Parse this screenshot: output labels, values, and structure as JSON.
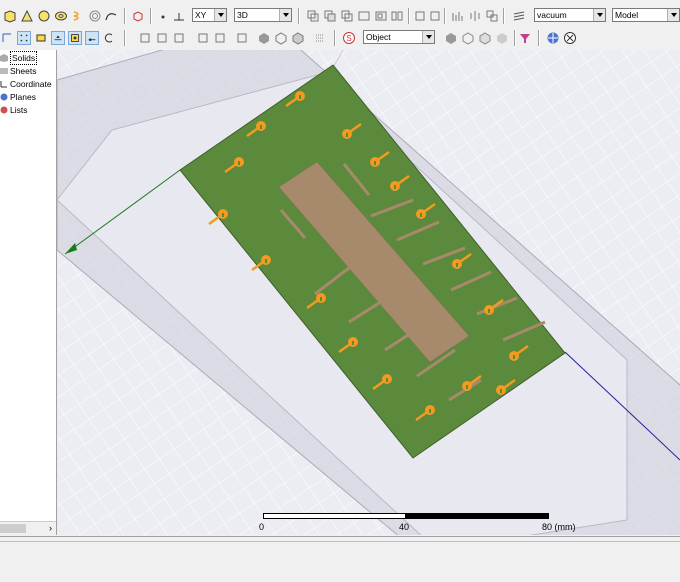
{
  "toolbar": {
    "plane_select": "XY",
    "view_select": "3D",
    "material_select": "vacuum",
    "mode_select": "Model",
    "object_select": "Object"
  },
  "tree": {
    "items": [
      {
        "label": "Solids"
      },
      {
        "label": "Sheets"
      },
      {
        "label": "Coordinate"
      },
      {
        "label": "Planes"
      },
      {
        "label": "Lists"
      }
    ]
  },
  "viewport": {
    "scale": {
      "ticks": [
        "0",
        "40",
        "80 (mm)"
      ]
    },
    "colors": {
      "substrate": "#5c8a3c",
      "microstrip": "#a78a6c",
      "ports": "#f39a1f",
      "region": "#d4d4de",
      "grid": "#ffffff"
    }
  }
}
